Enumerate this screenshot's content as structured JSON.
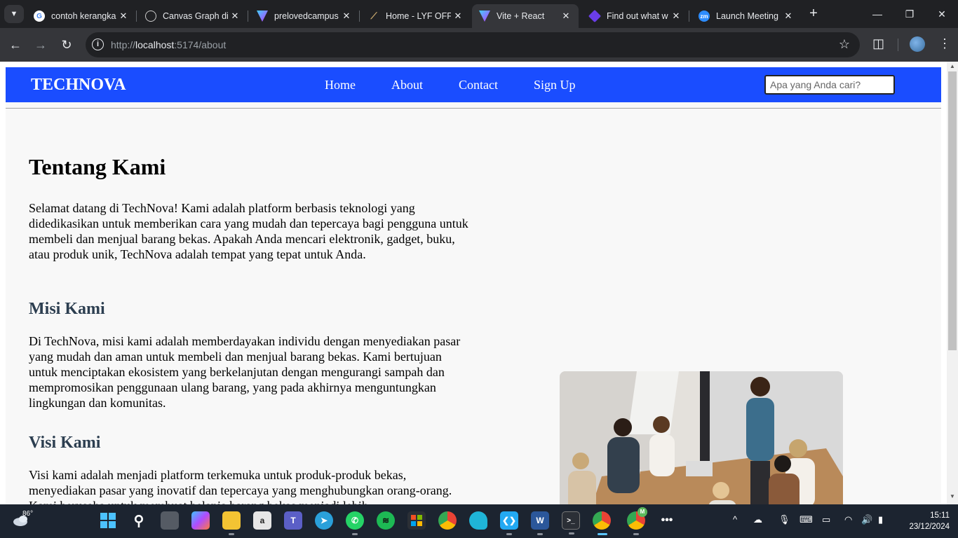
{
  "browser": {
    "tabs": [
      {
        "title": "contoh kerangka",
        "favicon": "google-icon",
        "color": "#ffffff",
        "active": false
      },
      {
        "title": "Canvas Graph di",
        "favicon": "openai-icon",
        "color": "#ffffff",
        "active": false
      },
      {
        "title": "prelovedcampus",
        "favicon": "vite-icon",
        "color": "#a259ff",
        "active": false
      },
      {
        "title": "Home - LYF OFF",
        "favicon": "lyf-icon",
        "color": "#c9a96e",
        "active": false
      },
      {
        "title": "Vite + React",
        "favicon": "vite-icon",
        "color": "#a259ff",
        "active": true
      },
      {
        "title": "Find out what w",
        "favicon": "diamond-icon",
        "color": "#6a3de8",
        "active": false
      },
      {
        "title": "Launch Meeting",
        "favicon": "zoom-icon",
        "color": "#2d8cff",
        "active": false
      }
    ],
    "url_host": "localhost",
    "url_prefix": "http://",
    "url_rest": ":5174/about"
  },
  "page": {
    "brand": "TECHNOVA",
    "nav": [
      "Home",
      "About",
      "Contact",
      "Sign Up"
    ],
    "search_placeholder": "Apa yang Anda cari?",
    "title": "Tentang Kami",
    "intro": "Selamat datang di TechNova! Kami adalah platform berbasis teknologi yang didedikasikan untuk memberikan cara yang mudah dan tepercaya bagi pengguna untuk membeli dan menjual barang bekas. Apakah Anda mencari elektronik, gadget, buku, atau produk unik, TechNova adalah tempat yang tepat untuk Anda.",
    "mission_heading": "Misi Kami",
    "mission_text": "Di TechNova, misi kami adalah memberdayakan individu dengan menyediakan pasar yang mudah dan aman untuk membeli dan menjual barang bekas. Kami bertujuan untuk menciptakan ekosistem yang berkelanjutan dengan mengurangi sampah dan mempromosikan penggunaan ulang barang, yang pada akhirnya menguntungkan lingkungan dan komunitas.",
    "vision_heading": "Visi Kami",
    "vision_text": "Visi kami adalah menjadi platform terkemuka untuk produk-produk bekas, menyediakan pasar yang inovatif dan tepercaya yang menghubungkan orang-orang. Kami berusaha untuk membuat belanja barang bekas menjadi lebih"
  },
  "taskbar": {
    "weather_temp": "86°",
    "time": "15:11",
    "date": "23/12/2024",
    "chrome_badge": "M"
  },
  "colors": {
    "navbar": "#1a4dff",
    "accent_blue": "#1a73e8"
  }
}
